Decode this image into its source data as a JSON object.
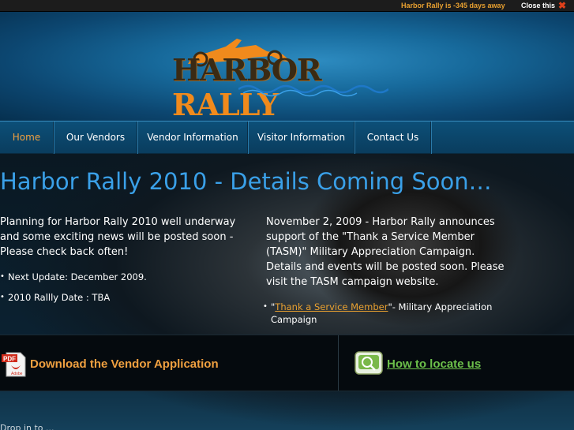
{
  "topbar": {
    "countdown": "Harbor Rally is -345 days away",
    "close_label": "Close this",
    "close_icon": "close-x-icon"
  },
  "header": {
    "logo_harbor": "HARBOR",
    "logo_rally": "RALLY"
  },
  "nav": {
    "items": [
      {
        "label": "Home",
        "active": true
      },
      {
        "label": "Our Vendors"
      },
      {
        "label": "Vendor Information"
      },
      {
        "label": "Visitor Information"
      },
      {
        "label": "Contact Us"
      }
    ]
  },
  "main": {
    "headline": "Harbor Rally 2010 - Details Coming Soon…",
    "left": {
      "paragraph": "Planning for Harbor Rally 2010 well underway and some exciting news will be posted soon - Please check back often!",
      "bullets": [
        "Next Update: December 2009.",
        "2010 Rallly Date : TBA"
      ]
    },
    "right": {
      "paragraph": "November 2, 2009 - Harbor Rally announces support of the \"Thank a Service Member (TASM)\" Military Appreciation Campaign. Details and events will be posted soon. Please visit the TASM campaign website.",
      "bullet_prefix": "\"",
      "bullet_link": "Thank a Service Member",
      "bullet_suffix": "\"- Military Appreciation Campaign"
    }
  },
  "panel": {
    "download_label": "Download the Vendor Application",
    "pdf_icon_label": "PDF",
    "pdf_icon_sub": "Adobe",
    "locate_label": "How to locate us"
  },
  "footer": {
    "partial_text": "Drop in to ..."
  },
  "colors": {
    "accent_orange": "#f0a040",
    "headline_blue": "#3aa0e8",
    "link_green": "#6cc04a"
  }
}
